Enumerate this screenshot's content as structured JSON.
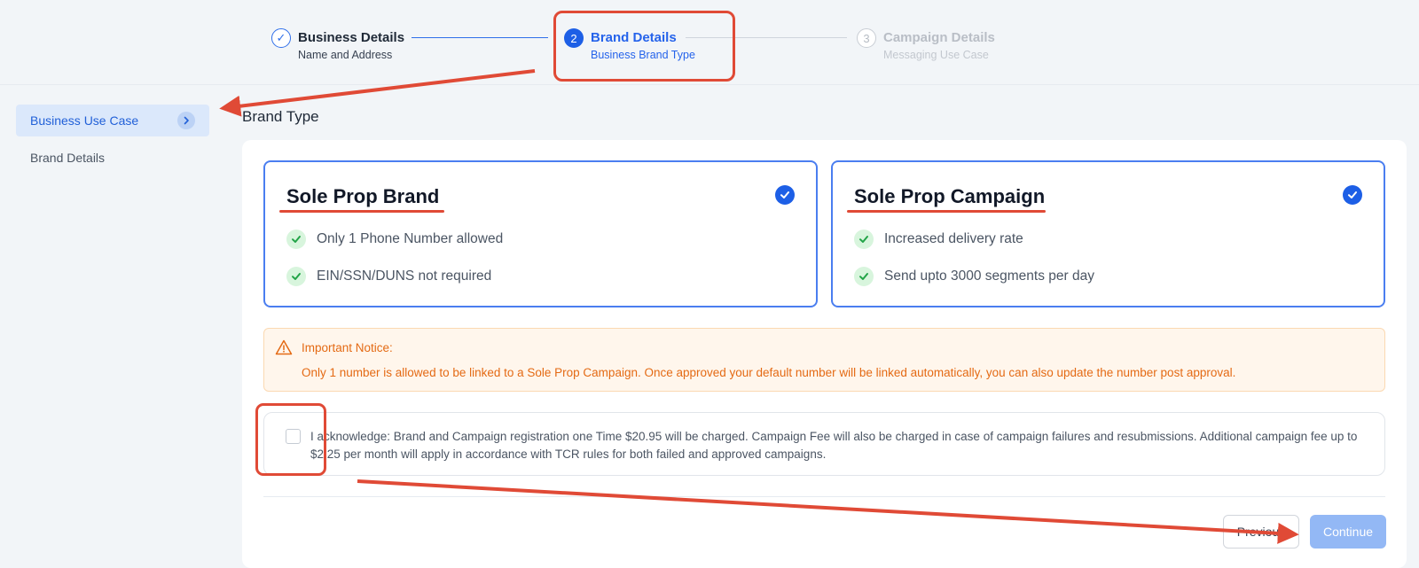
{
  "stepper": {
    "steps": [
      {
        "indicator": "✓",
        "title": "Business Details",
        "subtitle": "Name and Address"
      },
      {
        "indicator": "2",
        "title": "Brand Details",
        "subtitle": "Business Brand Type"
      },
      {
        "indicator": "3",
        "title": "Campaign Details",
        "subtitle": "Messaging Use Case"
      }
    ]
  },
  "sidebar": {
    "items": [
      {
        "label": "Business Use Case",
        "icon": "chevron-right-icon"
      },
      {
        "label": "Brand Details"
      }
    ]
  },
  "main": {
    "section_title": "Brand Type",
    "cards": [
      {
        "title": "Sole Prop Brand",
        "features": [
          "Only 1 Phone Number allowed",
          "EIN/SSN/DUNS not required"
        ]
      },
      {
        "title": "Sole Prop Campaign",
        "features": [
          "Increased delivery rate",
          "Send upto 3000 segments per day"
        ]
      }
    ],
    "notice": {
      "title": "Important Notice:",
      "text": "Only 1 number is allowed to be linked to a Sole Prop Campaign. Once approved your default number will be linked automatically, you can also update the number post approval."
    },
    "acknowledge": {
      "text": "I acknowledge: Brand and Campaign registration one Time $20.95 will be charged. Campaign Fee will also be charged in case of campaign failures and resubmissions. Additional campaign fee up to $2.25 per month will apply in accordance with TCR rules for both failed and approved campaigns.",
      "checked": false
    },
    "buttons": {
      "previous": "Previous",
      "continue": "Continue"
    }
  },
  "colors": {
    "accent": "#1d5fe6",
    "annotation": "#e04a36",
    "notice_text": "#e46a14",
    "continue_disabled": "#93b8f5"
  }
}
